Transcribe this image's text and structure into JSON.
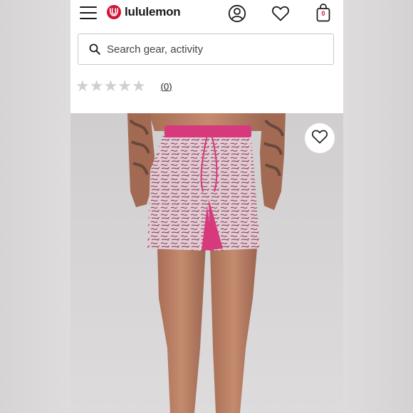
{
  "header": {
    "brand_name": "lululemon",
    "bag_count": "0",
    "icons": [
      "menu-icon",
      "lululemon-logo",
      "account-icon",
      "heart-icon",
      "shopping-bag-icon"
    ]
  },
  "search": {
    "placeholder": "Search gear, activity",
    "value": ""
  },
  "rating": {
    "stars_filled": 0,
    "stars_total": 5,
    "review_count": "(0)"
  },
  "product_image": {
    "description_icon": "favorite-heart-icon"
  },
  "colors": {
    "brand_red": "#d31334",
    "text": "#1a1a1a",
    "star_empty": "#cfcfcf",
    "shorts_pink": "#d63a7c"
  }
}
